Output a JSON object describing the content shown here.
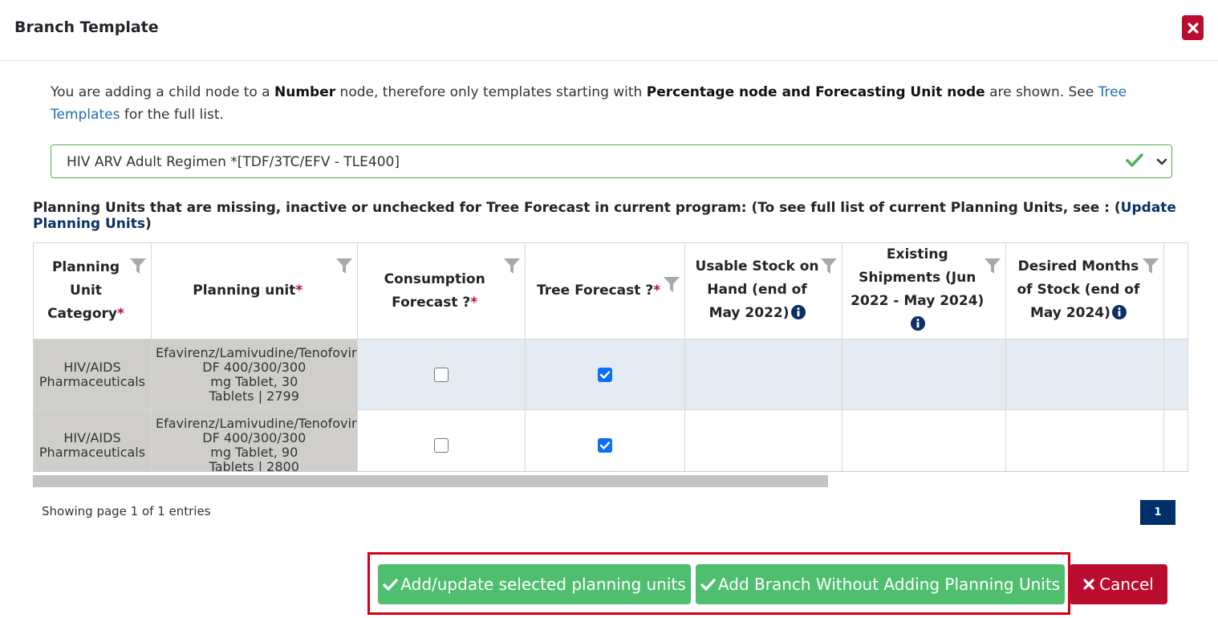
{
  "modal": {
    "title": "Branch Template"
  },
  "info": {
    "prefix": "You are adding a child node to a ",
    "node_type": "Number",
    "middle": " node, therefore only templates starting with ",
    "allowed": "Percentage node and Forecasting Unit node",
    "suffix": " are shown. See ",
    "link": "Tree Templates",
    "end": " for the full list."
  },
  "template_select": {
    "value": "HIV ARV Adult Regimen *[TDF/3TC/EFV - TLE400]"
  },
  "pu_heading": {
    "text": "Planning Units that are missing, inactive or unchecked for Tree Forecast in current program: (To see full list of current Planning Units, see : (",
    "link": "Update Planning Units",
    "end": ")"
  },
  "table": {
    "headers": [
      {
        "label": "Planning Unit Category",
        "required": "*"
      },
      {
        "label": "Planning unit",
        "required": "*"
      },
      {
        "label": "Consumption Forecast ?",
        "required": "*"
      },
      {
        "label": "Tree Forecast ?",
        "required": "*"
      },
      {
        "label": "Usable Stock on Hand (end of May 2022)"
      },
      {
        "label": "Existing Shipments (Jun 2022 - May 2024)"
      },
      {
        "label": "Desired Months of Stock (end of May 2024)"
      }
    ],
    "rows": [
      {
        "category_line1": "HIV/AIDS",
        "category_line2": "Pharmaceuticals",
        "unit_line1": "Efavirenz/Lamivudine/Tenofovir",
        "unit_line2": "DF 400/300/300",
        "unit_line3": "mg Tablet, 30",
        "unit_line4": "Tablets | 2799",
        "consumption_forecast": false,
        "tree_forecast": true
      },
      {
        "category_line1": "HIV/AIDS",
        "category_line2": "Pharmaceuticals",
        "unit_line1": "Efavirenz/Lamivudine/Tenofovir",
        "unit_line2": "DF 400/300/300",
        "unit_line3": "mg Tablet, 90",
        "unit_line4": "Tablets | 2800",
        "consumption_forecast": false,
        "tree_forecast": true
      }
    ]
  },
  "pagination": {
    "showing": "Showing page 1 of 1 entries",
    "current_page": "1"
  },
  "buttons": {
    "add_update": "Add/update selected planning units",
    "add_branch": "Add Branch Without Adding Planning Units",
    "cancel": "Cancel"
  },
  "colors": {
    "accent_red": "#ba0c2f",
    "accent_green": "#4fbf6f",
    "navy": "#002f6c",
    "highlight_border": "#d40014"
  }
}
